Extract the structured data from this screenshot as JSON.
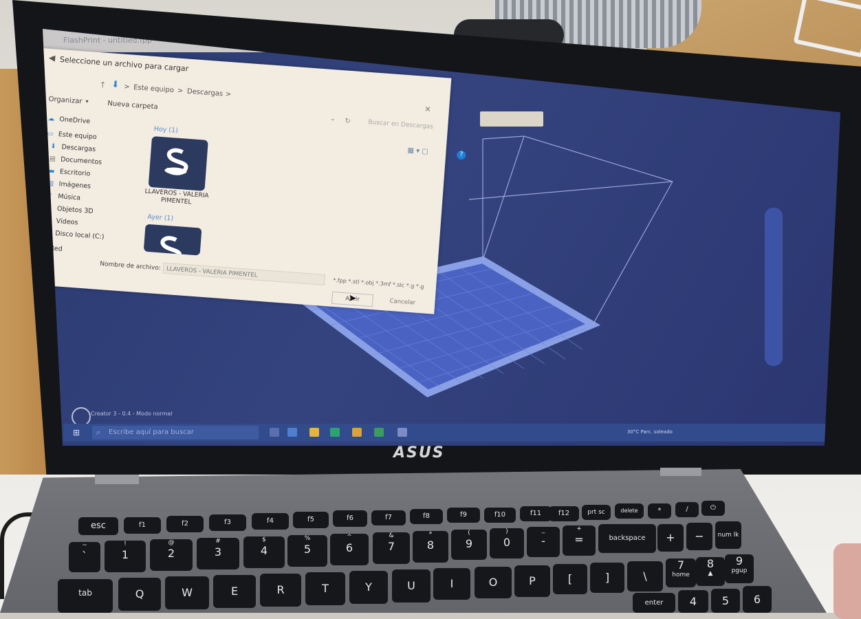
{
  "dialog": {
    "title": "Seleccione un archivo para cargar",
    "breadcrumb": [
      "Este equipo",
      "Descargas"
    ],
    "breadcrumb_sep": ">",
    "toolbar": {
      "organize": "Organizar",
      "new_folder": "Nueva carpeta",
      "search_placeholder": "Buscar en Descargas"
    },
    "nav_items": [
      {
        "label": "OneDrive",
        "icon": "cloud-icon"
      },
      {
        "label": "Este equipo",
        "icon": "computer-icon"
      },
      {
        "label": "Descargas",
        "icon": "download-icon"
      },
      {
        "label": "Documentos",
        "icon": "document-icon"
      },
      {
        "label": "Escritorio",
        "icon": "desktop-icon"
      },
      {
        "label": "Imágenes",
        "icon": "image-icon"
      },
      {
        "label": "Música",
        "icon": "music-icon"
      },
      {
        "label": "Objetos 3D",
        "icon": "cube-icon"
      },
      {
        "label": "Vídeos",
        "icon": "video-icon"
      },
      {
        "label": "Disco local (C:)",
        "icon": "disk-icon"
      },
      {
        "label": "Red",
        "icon": "network-icon"
      }
    ],
    "groups": {
      "today": "Hoy (1)",
      "yesterday": "Ayer (1)"
    },
    "files": [
      {
        "name": "LLAVEROS - VALERIA PIMENTEL"
      }
    ],
    "file_name_label": "Nombre de archivo:",
    "file_name_value": "LLAVEROS - VALERIA PIMENTEL",
    "file_types": "*.fpp *.stl *.obj *.3mf *.slc *.g *.g",
    "open_label": "Abrir",
    "cancel_label": "Cancelar",
    "close_glyph": "×",
    "help_glyph": "?"
  },
  "app": {
    "title": "FlashPrint - untitled.fpp",
    "status": "Creator 3 - 0.4 - Modo normal"
  },
  "taskbar": {
    "search_placeholder": "Escribe aquí para buscar",
    "tray": "30°C  Parc. soleado"
  },
  "laptop_brand": "ASUS",
  "keyboard": {
    "row1": [
      "esc",
      "f1",
      "f2",
      "f3",
      "f4",
      "f5",
      "f6",
      "f7",
      "f8",
      "f9",
      "f10",
      "f11",
      "f12",
      "prt sc",
      "delete",
      "*",
      "/",
      "⏻"
    ],
    "row2": [
      "1",
      "2",
      "3",
      "4",
      "5",
      "6",
      "7",
      "8",
      "9",
      "0",
      "-",
      "=",
      "backspace",
      "+",
      "−",
      "num lk"
    ],
    "row3": [
      "tab",
      "Q",
      "W",
      "E",
      "R",
      "T",
      "Y",
      "U",
      "I",
      "O",
      "P",
      "[",
      "]",
      "\\",
      "7",
      "8",
      "9"
    ],
    "row2_shift": [
      "!",
      "@",
      "#",
      "$",
      "%",
      "^",
      "&",
      "*",
      "(",
      ")",
      "_",
      "+"
    ],
    "row3_sub": [
      "home",
      "▲",
      "pgup"
    ],
    "enter": "enter",
    "row4": [
      "4",
      "5",
      "6"
    ]
  },
  "colors": {
    "viewport": "#34437e",
    "dialog_bg": "#f3ece1",
    "accent_blue": "#1f7fd6",
    "taskbar": "#324b8c"
  }
}
